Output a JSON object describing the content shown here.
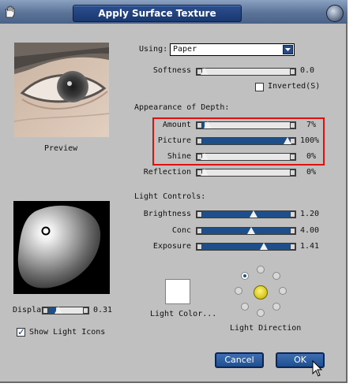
{
  "window": {
    "title": "Apply Surface Texture"
  },
  "preview": {
    "label": "Preview"
  },
  "texture": {
    "using_label": "Using:",
    "using_value": "Paper"
  },
  "softness": {
    "label": "Softness",
    "value": "0.0",
    "level": 0.0
  },
  "inverted": {
    "label": "Inverted",
    "accelerator": "(S)",
    "checked": false
  },
  "depth": {
    "heading": "Appearance of Depth:",
    "amount": {
      "label": "Amount",
      "value": "7%",
      "level": 0.07
    },
    "picture": {
      "label": "Picture",
      "value": "100%",
      "level": 1.0
    },
    "shine": {
      "label": "Shine",
      "value": "0%",
      "level": 0.0
    },
    "reflection": {
      "label": "Reflection",
      "value": "0%",
      "level": 0.0
    }
  },
  "light": {
    "heading": "Light Controls:",
    "brightness": {
      "label": "Brightness",
      "value": "1.20",
      "level": 0.6
    },
    "conc": {
      "label": "Conc",
      "value": "4.00",
      "level": 0.58
    },
    "exposure": {
      "label": "Exposure",
      "value": "1.41",
      "level": 0.65
    },
    "display": {
      "label": "Display",
      "value": "0.31",
      "level": 0.31
    },
    "show_icons": {
      "label": "Show Light Icons",
      "checked": true
    },
    "color_label": "Light Color...",
    "direction_label": "Light Direction"
  },
  "buttons": {
    "cancel": "Cancel",
    "ok": "OK"
  },
  "colors": {
    "accent": "#1f4f8a",
    "highlight_box": "#e01010",
    "dialog_bg": "#c0c0c0"
  },
  "icons": [
    "hand-icon",
    "window-orb-icon",
    "dropdown-arrow-icon",
    "light-source-icon",
    "mouse-cursor-icon"
  ]
}
